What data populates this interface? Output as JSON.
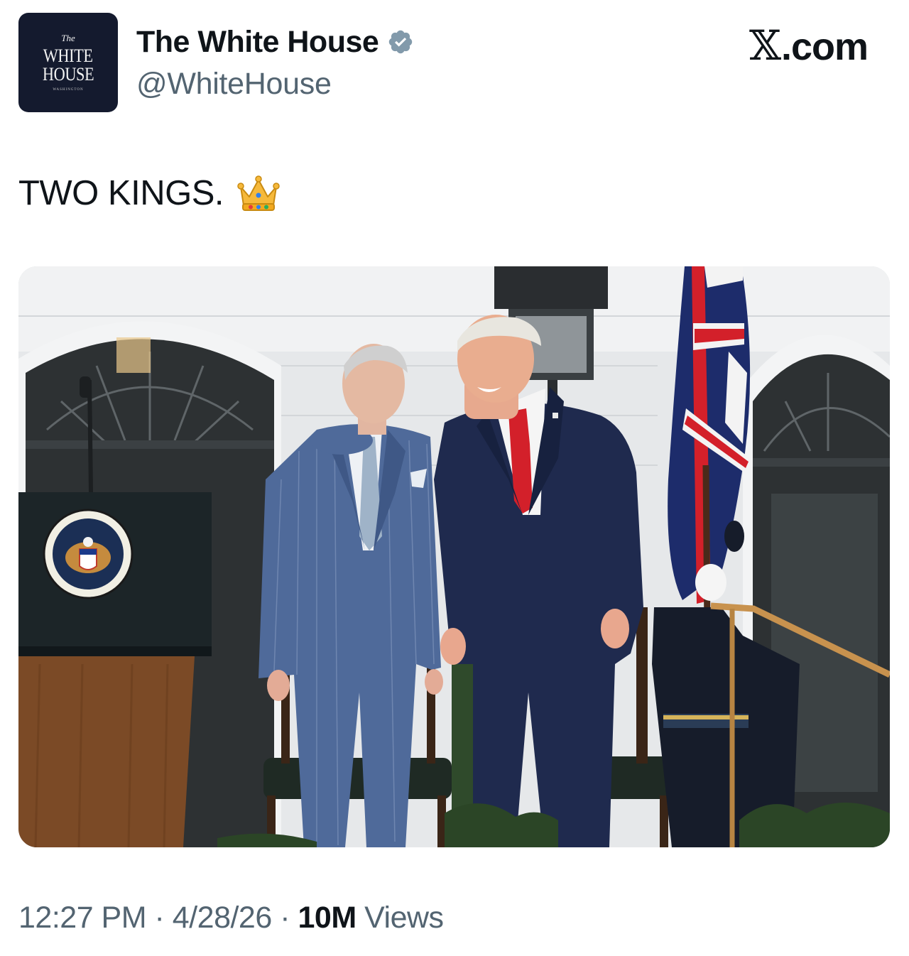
{
  "account": {
    "avatar_text": {
      "line1": "The",
      "line2": "WHITE",
      "line3": "HOUSE",
      "line4": "WASHINGTON"
    },
    "display_name": "The White House",
    "handle": "@WhiteHouse",
    "verified_badge_color": "#829aab",
    "verified_icon": "verified-badge-icon"
  },
  "brand": {
    "label": ".com",
    "mark": "𝕏"
  },
  "post": {
    "text": "TWO KINGS.",
    "emoji": "crown-icon"
  },
  "meta": {
    "time": "12:27 PM",
    "separator": "·",
    "date": "4/28/26",
    "views_count": "10M",
    "views_label": "Views"
  },
  "colors": {
    "text_primary": "#0f1419",
    "text_secondary": "#536471",
    "avatar_bg": "#141a2e",
    "navy_suit": "#1f2a4e",
    "tie_red": "#d3202a"
  }
}
